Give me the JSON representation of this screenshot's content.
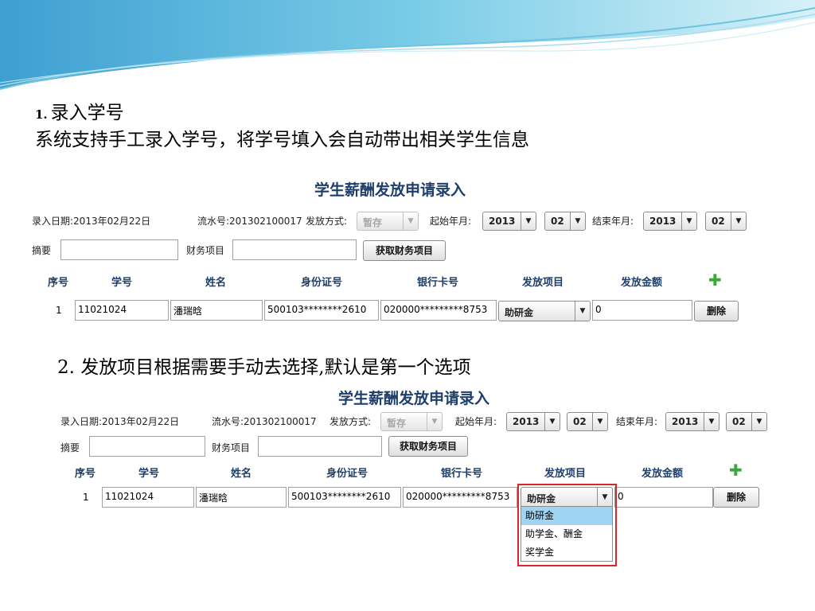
{
  "section1": {
    "number": "1.",
    "title": "录入学号",
    "description": "系统支持手工录入学号，将学号填入会自动带出相关学生信息"
  },
  "section2": {
    "title": "2.  发放项目根据需要手动去选择,默认是第一个选项"
  },
  "form": {
    "title": "学生薪酬发放申请录入",
    "entry_date": "录入日期:2013年02月22日",
    "serial_no": "流水号:201302100017",
    "payment_method_label": "发放方式:",
    "payment_method_value": "暂存",
    "start_label": "起始年月:",
    "start_year": "2013",
    "start_month": "02",
    "end_label": "结束年月:",
    "end_year": "2013",
    "end_month": "02",
    "summary_label": "摘要",
    "finance_item_label": "财务项目",
    "get_finance_button": "获取财务项目",
    "columns": [
      "序号",
      "学号",
      "姓名",
      "身份证号",
      "银行卡号",
      "发放项目",
      "发放金额"
    ],
    "row": {
      "index": "1",
      "student_id": "11021024",
      "name": "潘瑞晗",
      "id_card": "500103********2610",
      "bank_card": "020000*********8753",
      "payment_item": "助研金",
      "amount": "0",
      "delete_button": "删除"
    },
    "dropdown_options": [
      "助研金",
      "助学金、酬金",
      "奖学金"
    ]
  },
  "icons": {
    "arrow": "▼",
    "plus": "✚"
  },
  "colors": {
    "title": "#1e3f6b",
    "plus_icon": "#3aa93a",
    "highlight_box": "#d9262c",
    "option_highlight": "#9fd4f2"
  }
}
